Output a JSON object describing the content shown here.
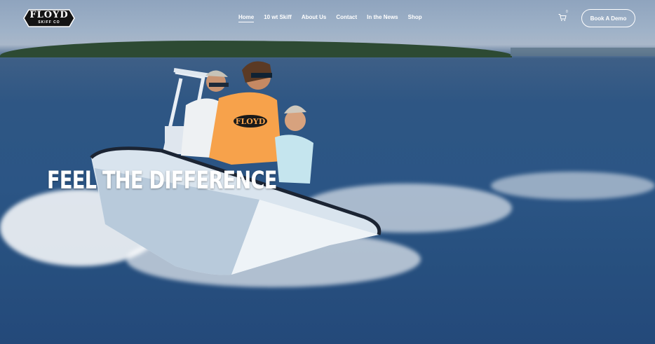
{
  "brand": {
    "logo_text": "FLOYD",
    "logo_sub": "SKIFF CO"
  },
  "nav": {
    "items": [
      {
        "label": "Home",
        "active": true
      },
      {
        "label": "10 wt Skiff",
        "active": false
      },
      {
        "label": "About Us",
        "active": false
      },
      {
        "label": "Contact",
        "active": false
      },
      {
        "label": "In the News",
        "active": false
      },
      {
        "label": "Shop",
        "active": false
      }
    ]
  },
  "cart": {
    "count": "0",
    "icon": "cart-icon"
  },
  "cta": {
    "label": "Book A Demo"
  },
  "hero": {
    "headline": "FEEL THE DIFFERENCE",
    "shirt_logo": "FLOYD"
  },
  "colors": {
    "water": "#2b5585",
    "sky": "#9fb2c8",
    "shirt": "#f7a24b"
  }
}
